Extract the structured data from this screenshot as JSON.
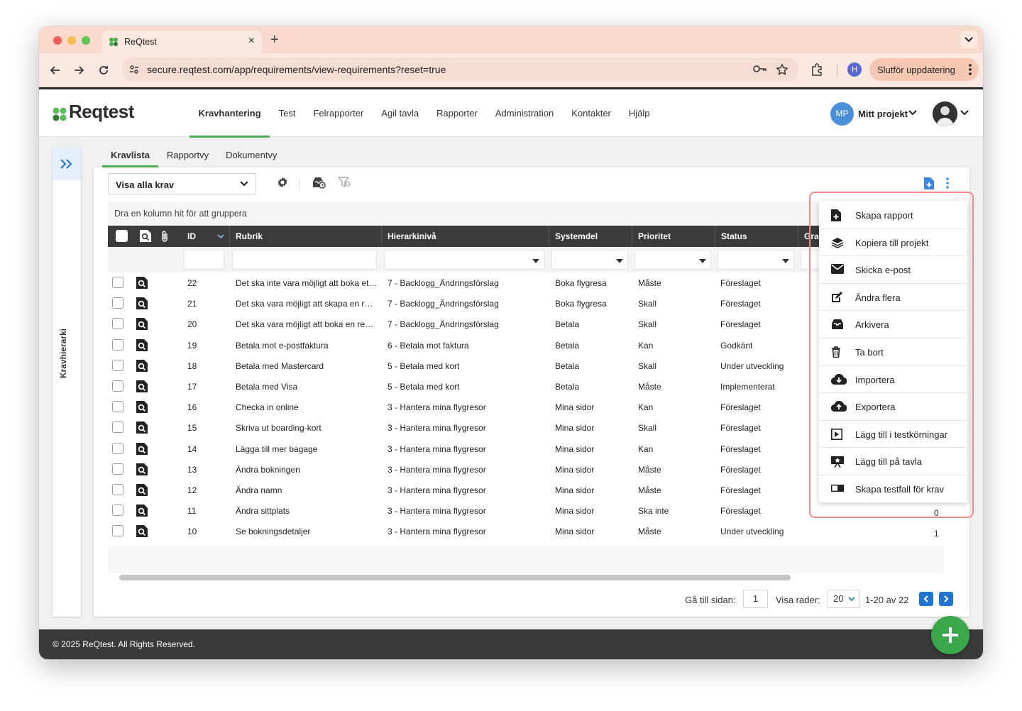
{
  "browser": {
    "tab_title": "ReQtest",
    "url": "secure.reqtest.com/app/requirements/view-requirements?reset=true",
    "profile_initial": "H",
    "update_label": "Slutför uppdatering"
  },
  "app": {
    "logo": "Reqtest",
    "nav": [
      "Kravhantering",
      "Test",
      "Felrapporter",
      "Agil tavla",
      "Rapporter",
      "Administration",
      "Kontakter",
      "Hjälp"
    ],
    "active_nav": "Kravhantering",
    "project_initials": "MP",
    "project_name": "Mitt projekt",
    "side_label": "Kravhierarki",
    "view_tabs": [
      "Kravlista",
      "Rapportvy",
      "Dokumentvy"
    ],
    "active_view_tab": "Kravlista",
    "filter_select": "Visa alla krav",
    "group_hint": "Dra en kolumn hit för att gruppera",
    "footer": "© 2025 ReQtest. All Rights Reserved.",
    "colors": {
      "accent_green": "#4caf50",
      "primary_blue": "#1f74d0",
      "header_dark": "#3b3b3b",
      "highlight_red": "#f08a8a"
    }
  },
  "grid": {
    "columns": [
      "ID",
      "Rubrik",
      "Hierarkinivå",
      "Systemdel",
      "Prioritet",
      "Status",
      "Gra"
    ],
    "rows": [
      {
        "id": "22",
        "rubrik": "Det ska inte vara möjligt att boka ett ...",
        "niva": "7 - Backlogg_Ändringsförslag",
        "systemdel": "Boka flygresa",
        "prioritet": "Måste",
        "status": "Föreslaget"
      },
      {
        "id": "21",
        "rubrik": "Det ska vara möjligt att skapa en rap...",
        "niva": "7 - Backlogg_Ändringsförslag",
        "systemdel": "Boka flygresa",
        "prioritet": "Skall",
        "status": "Föreslaget"
      },
      {
        "id": "20",
        "rubrik": "Det ska vara möjligt att boka en resa ...",
        "niva": "7 - Backlogg_Ändringsförslag",
        "systemdel": "Betala",
        "prioritet": "Skall",
        "status": "Föreslaget"
      },
      {
        "id": "19",
        "rubrik": "Betala mot e-postfaktura",
        "niva": "6 - Betala mot faktura",
        "systemdel": "Betala",
        "prioritet": "Kan",
        "status": "Godkänt"
      },
      {
        "id": "18",
        "rubrik": "Betala med Mastercard",
        "niva": "5 - Betala med kort",
        "systemdel": "Betala",
        "prioritet": "Skall",
        "status": "Under utveckling"
      },
      {
        "id": "17",
        "rubrik": "Betala med Visa",
        "niva": "5 - Betala med kort",
        "systemdel": "Betala",
        "prioritet": "Måste",
        "status": "Implementerat"
      },
      {
        "id": "16",
        "rubrik": "Checka in online",
        "niva": "3 - Hantera mina flygresor",
        "systemdel": "Mina sidor",
        "prioritet": "Kan",
        "status": "Föreslaget"
      },
      {
        "id": "15",
        "rubrik": "Skriva ut boarding-kort",
        "niva": "3 - Hantera mina flygresor",
        "systemdel": "Mina sidor",
        "prioritet": "Skall",
        "status": "Föreslaget"
      },
      {
        "id": "14",
        "rubrik": "Lägga till mer bagage",
        "niva": "3 - Hantera mina flygresor",
        "systemdel": "Mina sidor",
        "prioritet": "Kan",
        "status": "Föreslaget"
      },
      {
        "id": "13",
        "rubrik": "Ändra bokningen",
        "niva": "3 - Hantera mina flygresor",
        "systemdel": "Mina sidor",
        "prioritet": "Måste",
        "status": "Föreslaget"
      },
      {
        "id": "12",
        "rubrik": "Ändra namn",
        "niva": "3 - Hantera mina flygresor",
        "systemdel": "Mina sidor",
        "prioritet": "Måste",
        "status": "Föreslaget"
      },
      {
        "id": "11",
        "rubrik": "Ändra sittplats",
        "niva": "3 - Hantera mina flygresor",
        "systemdel": "Mina sidor",
        "prioritet": "Ska inte",
        "status": "Föreslaget"
      },
      {
        "id": "10",
        "rubrik": "Se bokningsdetaljer",
        "niva": "3 - Hantera mina flygresor",
        "systemdel": "Mina sidor",
        "prioritet": "Måste",
        "status": "Under utveckling"
      }
    ],
    "trailing_values": {
      "row_11": "0",
      "row_10": "1"
    }
  },
  "pager": {
    "goto_label": "Gå till sidan:",
    "page": "1",
    "rows_label": "Visa rader:",
    "rows_per_page": "20",
    "range": "1-20 av 22"
  },
  "menu": {
    "items": [
      {
        "label": "Skapa rapport",
        "icon": "file-plus-icon"
      },
      {
        "label": "Kopiera till projekt",
        "icon": "layers-icon"
      },
      {
        "label": "Skicka e-post",
        "icon": "envelope-icon"
      },
      {
        "label": "Ändra flera",
        "icon": "edit-icon"
      },
      {
        "label": "Arkivera",
        "icon": "archive-icon"
      },
      {
        "label": "Ta bort",
        "icon": "trash-icon"
      },
      {
        "label": "Importera",
        "icon": "cloud-download-icon"
      },
      {
        "label": "Exportera",
        "icon": "cloud-upload-icon"
      },
      {
        "label": "Lägg till i testkörningar",
        "icon": "play-square-icon"
      },
      {
        "label": "Lägg till på tavla",
        "icon": "board-icon"
      },
      {
        "label": "Skapa testfall för krav",
        "icon": "toggle-icon"
      }
    ]
  }
}
